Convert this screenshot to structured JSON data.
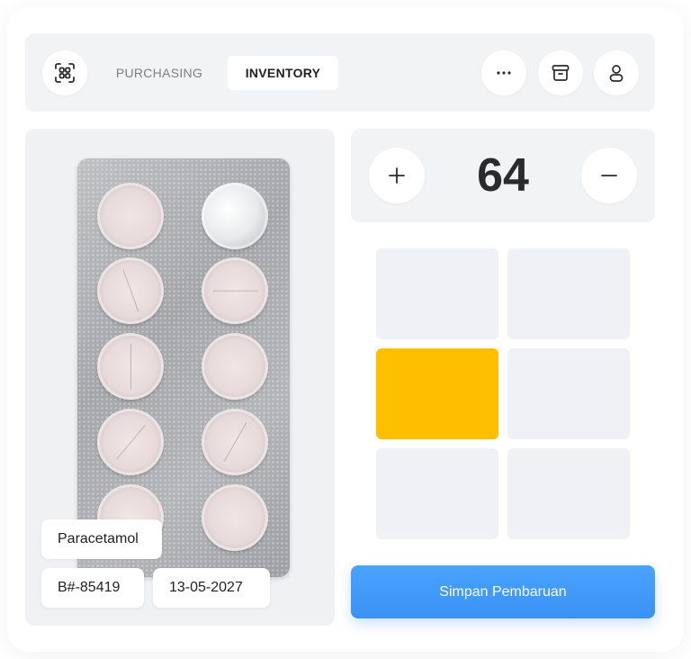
{
  "header": {
    "tabs": [
      {
        "label": "PURCHASING",
        "active": false
      },
      {
        "label": "INVENTORY",
        "active": true
      }
    ],
    "icons": {
      "scan": "scan-icon",
      "more": "more-horizontal-icon",
      "archive": "archive-icon",
      "user": "user-icon"
    }
  },
  "product": {
    "name": "Paracetamol",
    "batch": "B#-85419",
    "expiry": "13-05-2027"
  },
  "counter": {
    "value": "64",
    "increment_icon": "plus-icon",
    "decrement_icon": "minus-icon"
  },
  "grid": {
    "rows": 3,
    "cols": 2,
    "selected_index": 2,
    "selected_color": "#fdbf00",
    "cell_color": "#f0f1f5"
  },
  "actions": {
    "save_label": "Simpan Pembaruan",
    "save_color": "#3a91f2"
  }
}
